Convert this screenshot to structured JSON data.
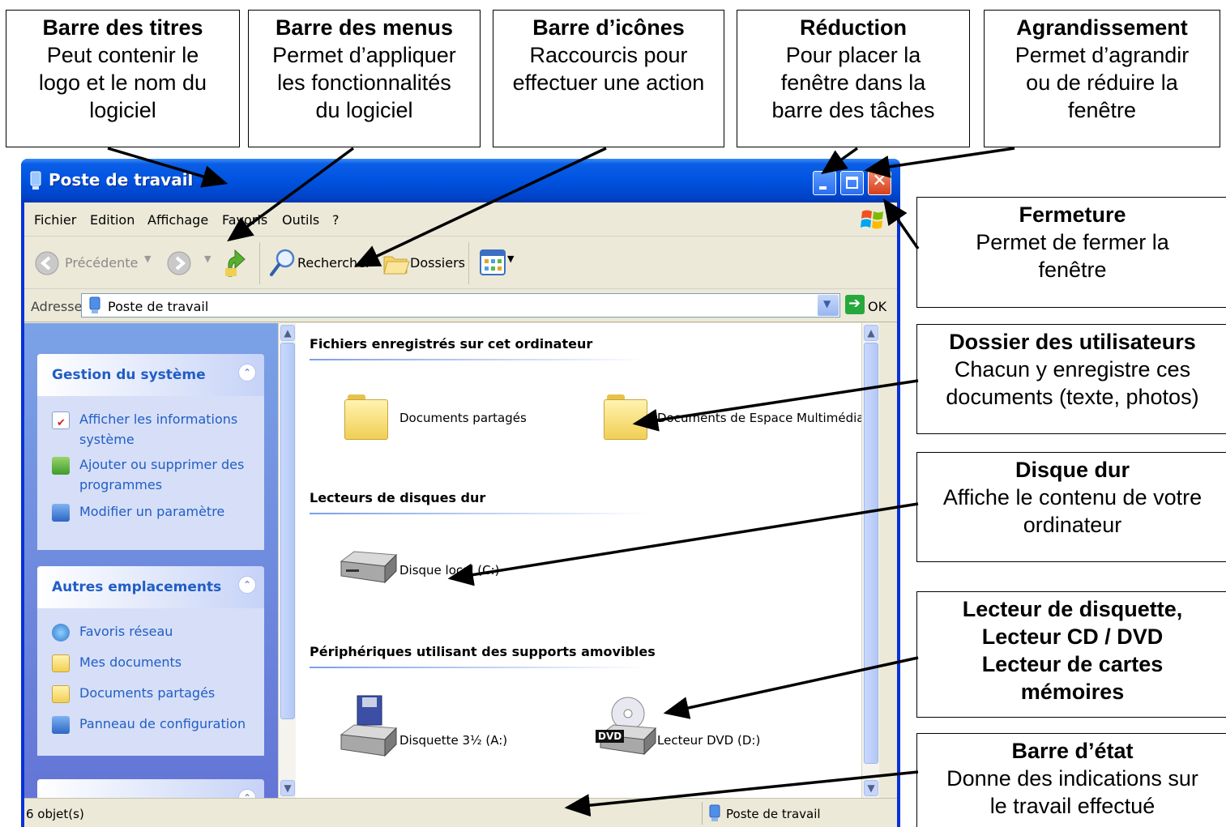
{
  "annotations": {
    "titlebar": {
      "title": "Barre des titres",
      "text": [
        "Peut contenir le",
        "logo et le nom du",
        "logiciel"
      ]
    },
    "menubar": {
      "title": "Barre des menus",
      "text": [
        "Permet d’appliquer",
        "les fonctionnalités",
        "du logiciel"
      ]
    },
    "iconbar": {
      "title": "Barre d’icônes",
      "text": [
        "Raccourcis pour",
        "effectuer une action"
      ]
    },
    "minimize": {
      "title": "Réduction",
      "text": [
        "Pour placer la",
        "fenêtre dans la",
        "barre des tâches"
      ]
    },
    "maximize": {
      "title": "Agrandissement",
      "text": [
        "Permet d’agrandir",
        "ou de réduire la",
        "fenêtre"
      ]
    },
    "close": {
      "title": "Fermeture",
      "text": [
        "Permet de fermer la",
        "fenêtre"
      ]
    },
    "userfolder": {
      "title": "Dossier des utilisateurs",
      "text": [
        "Chacun y enregistre ces",
        "documents (texte, photos)"
      ]
    },
    "harddisk": {
      "title": "Disque dur",
      "text": [
        "Affiche le contenu de votre",
        "ordinateur"
      ]
    },
    "removable": {
      "title": [
        "Lecteur de disquette,",
        "Lecteur CD / DVD",
        "Lecteur de cartes",
        "mémoires"
      ]
    },
    "statusbar": {
      "title": "Barre d’état",
      "text": [
        "Donne des indications sur",
        "le travail effectué"
      ]
    }
  },
  "window": {
    "title": "Poste de travail",
    "menu": [
      "Fichier",
      "Edition",
      "Affichage",
      "Favoris",
      "Outils",
      "?"
    ],
    "toolbar": {
      "back": "Précédente",
      "search": "Rechercher",
      "folders": "Dossiers"
    },
    "address": {
      "label": "Adresse",
      "value": "Poste de travail",
      "go": "OK"
    },
    "sidebar": {
      "system": {
        "title": "Gestion du système",
        "tasks": [
          "Afficher les informations système",
          "Ajouter ou supprimer des programmes",
          "Modifier un paramètre"
        ]
      },
      "places": {
        "title": "Autres emplacements",
        "links": [
          "Favoris réseau",
          "Mes documents",
          "Documents partagés",
          "Panneau de configuration"
        ]
      }
    },
    "groups": {
      "files": {
        "title": "Fichiers enregistrés sur cet ordinateur",
        "items": [
          "Documents partagés",
          "Documents de Espace Multimédia"
        ]
      },
      "disks": {
        "title": "Lecteurs de disques dur",
        "items": [
          "Disque local (C:)"
        ]
      },
      "removable": {
        "title": "Périphériques utilisant des supports amovibles",
        "items": [
          "Disquette 3½ (A:)",
          "Lecteur DVD (D:)"
        ],
        "dvd_badge": "DVD"
      }
    },
    "status": {
      "left": "6 objet(s)",
      "right": "Poste de travail"
    }
  },
  "colors": {
    "title_blue": "#0053e0",
    "task_blue": "#215dc6",
    "close_red": "#d6401a",
    "sidebar_blue": "#7ba2e7"
  }
}
